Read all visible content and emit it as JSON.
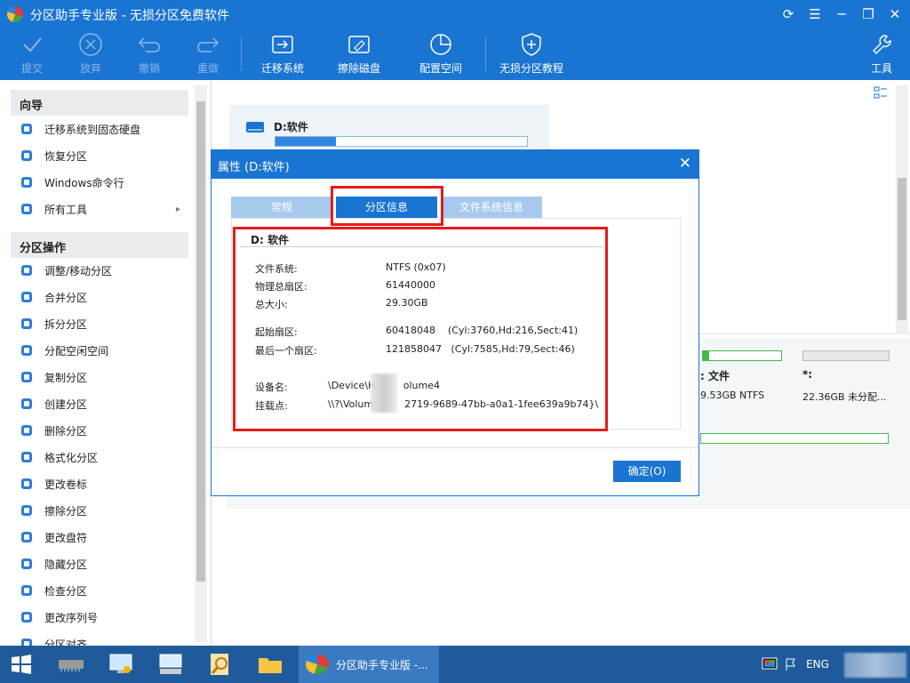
{
  "window": {
    "title": "分区助手专业版 - 无损分区免费软件"
  },
  "toolbar": {
    "commit": "提交",
    "discard": "放弃",
    "undo": "撤销",
    "redo": "重做",
    "migrate": "迁移系统",
    "wipe": "擦除磁盘",
    "allocate": "配置空间",
    "tutorial": "无损分区教程",
    "tools": "工具"
  },
  "sidebar": {
    "wizard_title": "向导",
    "wizard_items": [
      "迁移系统到固态硬盘",
      "恢复分区",
      "Windows命令行",
      "所有工具"
    ],
    "ops_title": "分区操作",
    "ops_items": [
      "调整/移动分区",
      "合并分区",
      "拆分分区",
      "分配空闲空间",
      "复制分区",
      "创建分区",
      "删除分区",
      "格式化分区",
      "更改卷标",
      "擦除分区",
      "更改盘符",
      "隐藏分区",
      "检查分区",
      "更改序列号",
      "分区对齐"
    ]
  },
  "main": {
    "partition_card_label": "D:软件",
    "disk_parts": [
      {
        "label": ": 文件",
        "info": "9.53GB NTFS"
      },
      {
        "label": "*:",
        "info": "22.36GB 未分配..."
      }
    ]
  },
  "dialog": {
    "title": "属性 (D:软件)",
    "tabs": [
      "常规",
      "分区信息",
      "文件系统信息"
    ],
    "heading": "D: 软件",
    "rows": [
      {
        "label": "文件系统:",
        "value": "NTFS (0x07)"
      },
      {
        "label": "物理总扇区:",
        "value": "61440000"
      },
      {
        "label": "总大小:",
        "value": "29.30GB"
      },
      {
        "label": "起始扇区:",
        "value": "60418048    (Cyl:3760,Hd:216,Sect:41)"
      },
      {
        "label": "最后一个扇区:",
        "value": "121858047   (Cyl:7585,Hd:79,Sect:46)"
      },
      {
        "label": "设备名:",
        "value": "\\Device\\H         olume4"
      },
      {
        "label": "挂载点:",
        "value": "\\\\?\\Volum          2719-9689-47bb-a0a1-1fee639a9b74}\\"
      }
    ],
    "ok": "确定(O)"
  },
  "taskbar": {
    "app_label": "分区助手专业版 -...",
    "lang": "ENG"
  },
  "colors": {
    "accent": "#1a74d2",
    "highlight": "#e31c1c"
  }
}
